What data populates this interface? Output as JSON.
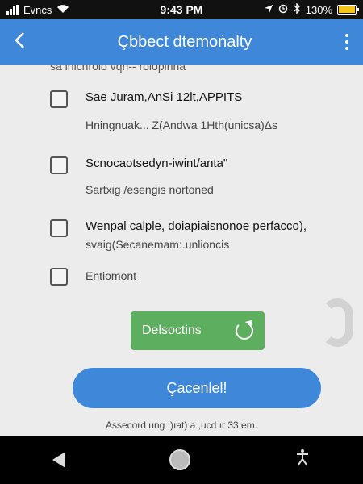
{
  "status_bar": {
    "carrier": "Evncs",
    "time": "9:43 PM",
    "battery": "130%",
    "battery_level": 1.0,
    "icons": [
      "signal-icon",
      "wifi-icon",
      "location-icon",
      "alarm-icon",
      "bluetooth-icon",
      "battery-icon"
    ]
  },
  "app_bar": {
    "title": "Çbbect dtemoṅalty",
    "back_icon": "chevron-left-icon",
    "menu_icon": "more-vertical-icon"
  },
  "list": {
    "partial_item": "sa lnicnrolo  vqri-- rolopinrla",
    "options": [
      {
        "title": "Sae Juram,AnSi 12lt,APPITS",
        "subtitle": "Hningnuak... Z(Andwa 1Hth(unicsa)Δs",
        "checked": false
      },
      {
        "title": "Scnocaotsedyn-iwint/anta\"",
        "subtitle": "Sartxig /esengis nortoned",
        "checked": false
      },
      {
        "title": "Wenpal calple, doiapiaisnonoe perfacco),",
        "subtitle": "svaig(Secanemam:.unlioncis",
        "checked": false
      },
      {
        "title": "Entiomont",
        "subtitle": "",
        "checked": false
      }
    ]
  },
  "actions": {
    "secondary_label": "Delsoctins",
    "secondary_icon": "refresh-icon",
    "primary_label": "Çacenlel!",
    "footer": "Assecord ung ;)ıat) a ,ucd ır 33 em."
  },
  "colors": {
    "accent": "#3f87d8",
    "success": "#5daf5f",
    "surface": "#ececec"
  },
  "nav_bar": {
    "icons": [
      "back-triangle-icon",
      "home-circle-icon",
      "accessibility-icon"
    ]
  }
}
